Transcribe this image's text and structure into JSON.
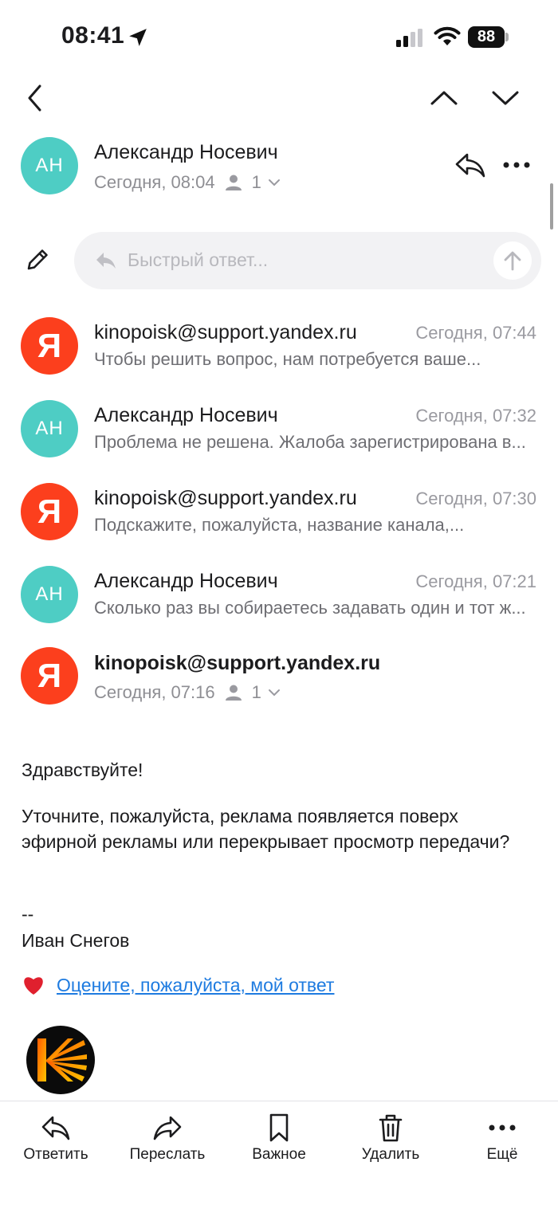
{
  "status_bar": {
    "time": "08:41",
    "battery": "88",
    "icons": [
      "location-arrow-icon",
      "cellular-signal-icon",
      "wifi-icon",
      "battery-icon"
    ]
  },
  "header": {
    "icons": [
      "back-chevron-icon",
      "previous-message-icon",
      "next-message-icon"
    ]
  },
  "current_message": {
    "avatar_initials": "АН",
    "sender": "Александр Носевич",
    "date": "Сегодня, 08:04",
    "recipients_count": "1",
    "icons": [
      "reply-icon",
      "more-icon"
    ]
  },
  "quick_reply": {
    "placeholder": "Быстрый ответ...",
    "icons": [
      "pencil-icon",
      "reply-arrow-icon",
      "send-up-arrow-icon"
    ]
  },
  "thread": [
    {
      "avatar": "Я",
      "sender": "kinopoisk@support.yandex.ru",
      "date": "Сегодня, 07:44",
      "preview": "Чтобы решить вопрос, нам потребуется ваше..."
    },
    {
      "avatar": "АН",
      "sender": "Александр Носевич",
      "date": "Сегодня, 07:32",
      "preview": "Проблема не решена. Жалоба зарегистрирована в..."
    },
    {
      "avatar": "Я",
      "sender": "kinopoisk@support.yandex.ru",
      "date": "Сегодня, 07:30",
      "preview": "Подскажите, пожалуйста, название канала,..."
    },
    {
      "avatar": "АН",
      "sender": "Александр Носевич",
      "date": "Сегодня, 07:21",
      "preview": "Сколько раз вы собираетесь задавать один и тот ж..."
    }
  ],
  "open_message": {
    "avatar": "Я",
    "sender": "kinopoisk@support.yandex.ru",
    "date": "Сегодня, 07:16",
    "recipients_count": "1",
    "greeting": "Здравствуйте!",
    "paragraph": "Уточните, пожалуйста, реклама появляется поверх эфирной рекламы или перекрывает просмотр передачи?",
    "signature_sep": "--",
    "signature_name": "Иван Снегов",
    "rate_link": "Оцените, пожалуйста, мой ответ",
    "logo": "kinopoisk-logo"
  },
  "toolbar": {
    "reply": "Ответить",
    "forward": "Переслать",
    "important": "Важное",
    "delete": "Удалить",
    "more": "Ещё"
  },
  "colors": {
    "avatar_an": "#4ecdc4",
    "avatar_yandex": "#fc3f1d",
    "link": "#1e7be0",
    "secondary_text": "#8e8e93"
  }
}
